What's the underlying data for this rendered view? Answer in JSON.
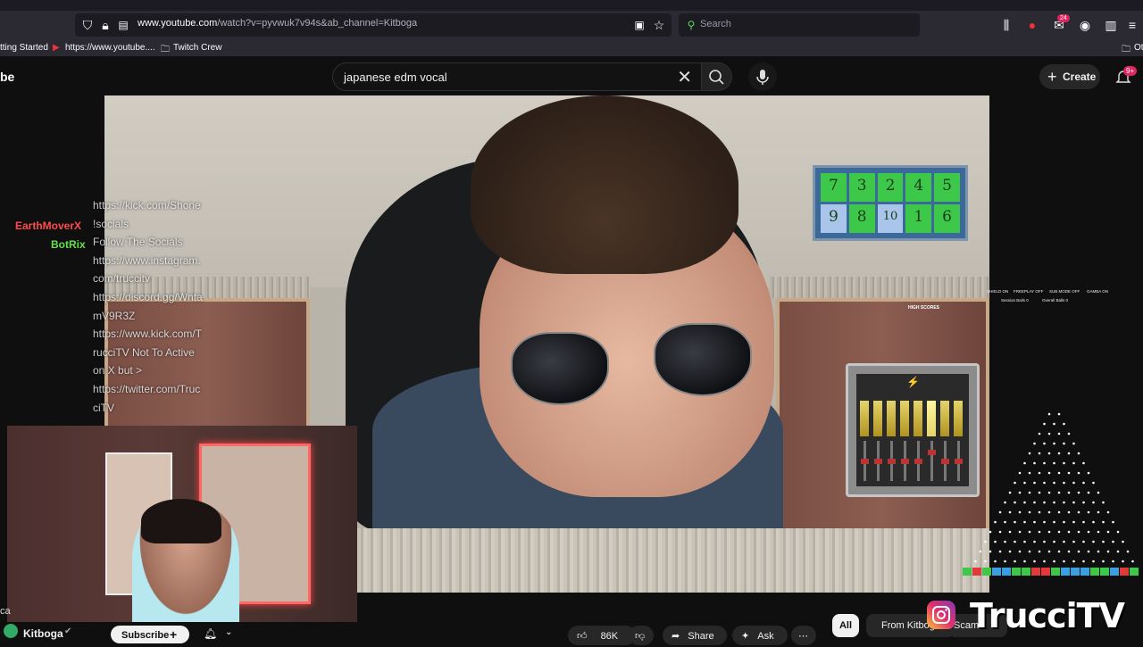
{
  "browser": {
    "url_host": "www.youtube.com",
    "url_path": "/watch?v=pyvwuk7v94s&ab_channel=Kitboga",
    "search_placeholder": "Search",
    "ext_badge": "24",
    "bookmarks": [
      "tting Started",
      "https://www.youtube....",
      "Twitch Crew"
    ],
    "bookmark_other": "Ot"
  },
  "youtube": {
    "logo_fragment": "be",
    "search_query": "japanese edm vocal",
    "create_label": "Create",
    "notif_badge": "9+"
  },
  "overlay_game": {
    "numbers_row1": [
      "7",
      "3",
      "2",
      "4",
      "5"
    ],
    "numbers_row2": [
      "9",
      "8",
      "10",
      "1",
      "6"
    ],
    "high_scores_label": "HIGH SCORES"
  },
  "chat": {
    "usernames": [
      {
        "name": "EarthMoverX",
        "color": "#ff4b4b"
      },
      {
        "name": "BotRix",
        "color": "#66e04a"
      }
    ],
    "lines": [
      "https://kick.com/Shone",
      "!socials",
      "Follow The Socials",
      "https://www.instagram.",
      "com/truccitv",
      "https://discord.gg/Wnta",
      "mV9R3Z",
      "https://www.kick.com/T",
      "rucciTV Not To Active",
      "on X but >",
      "https://twitter.com/Truc",
      "ciTV"
    ]
  },
  "stats_overlay": {
    "labels": [
      "SHIELD ON",
      "FREEPLAY OFF",
      "SUB MODE OFF",
      "GAMBA ON"
    ],
    "session_balls": "Session Balls 0",
    "overall_balls": "Overall Balls 0"
  },
  "bottom": {
    "channel_name": "Kitboga",
    "channel_prefix": "ca",
    "subscribe_label": "Subscribe",
    "likes": "86K",
    "share_label": "Share",
    "ask_label": "Ask",
    "chip_all": "All",
    "chip_from": "From Kitboga",
    "chip_scam": "Scam",
    "watermark": "TrucciTV"
  },
  "colors": {
    "youtube_bg": "#0f0f0f",
    "browser_toolbar": "#2b2a33",
    "accent_red": "#ff0000"
  }
}
